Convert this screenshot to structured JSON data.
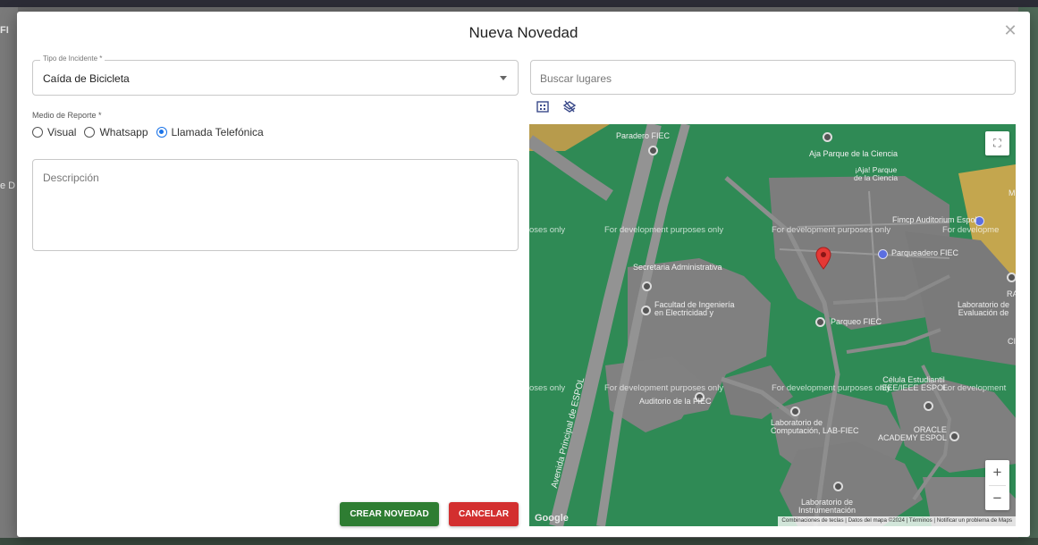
{
  "background": {
    "left_text_1": "FI",
    "left_text_2": "e D"
  },
  "modal": {
    "title": "Nueva Novedad",
    "close_icon": "close-icon"
  },
  "form": {
    "incident_type": {
      "label": "Tipo de Incidente *",
      "value": "Caída de Bicicleta"
    },
    "report_medium": {
      "label": "Medio de Reporte *",
      "options": [
        "Visual",
        "Whatsapp",
        "Llamada Telefónica"
      ],
      "selected": "Llamada Telefónica"
    },
    "description": {
      "placeholder": "Descripción"
    },
    "buttons": {
      "create": "CREAR NOVEDAD",
      "cancel": "CANCELAR"
    }
  },
  "map": {
    "search_placeholder": "Buscar lugares",
    "labels": {
      "paradero": "Paradero FIEC",
      "aja_parque": "Aja Parque de la Ciencia",
      "aja_parque_2": "¡Aja! Parque\nde la Ciencia",
      "fimcp": "Fimcp Auditorium Espol",
      "parqueadero": "Parqueadero FIEC",
      "secretaria": "Secretaria Administrativa",
      "facultad": "Facultad de Ingeniería\nen Electricidad y",
      "parqueo": "Parqueo FIEC",
      "lab_eval": "Laboratorio de\nEvaluación de",
      "celula": "Célula Estudiantil\nIEEE/IEEE ESPOL",
      "auditorio": "Auditorio de la FIEC",
      "lab_comp": "Laboratorio de\nComputación, LAB-FIEC",
      "oracle": "ORACLE\nACADEMY ESPOL",
      "lab_instr": "Laboratorio de\nInstrumentación",
      "avenue": "Avenida Principal de ESPOL",
      "ram": "RAI",
      "m": "M",
      "cib": "CIB"
    },
    "dev_watermark": "For development purposes only",
    "dev_partial_left": "oses only",
    "dev_partial_right": "For developme",
    "dev_partial_right2": "For development",
    "google_logo": "Google",
    "attribution": "Combinaciones de teclas  |  Datos del mapa ©2024  |  Términos  |  Notificar un problema de Maps",
    "zoom_in": "+",
    "zoom_out": "−"
  },
  "colors": {
    "map_green": "#2f8a55",
    "create_button": "#2e7d32",
    "cancel_button": "#d32f2f",
    "radio_selected": "#1a73e8",
    "pin": "#e53935"
  }
}
